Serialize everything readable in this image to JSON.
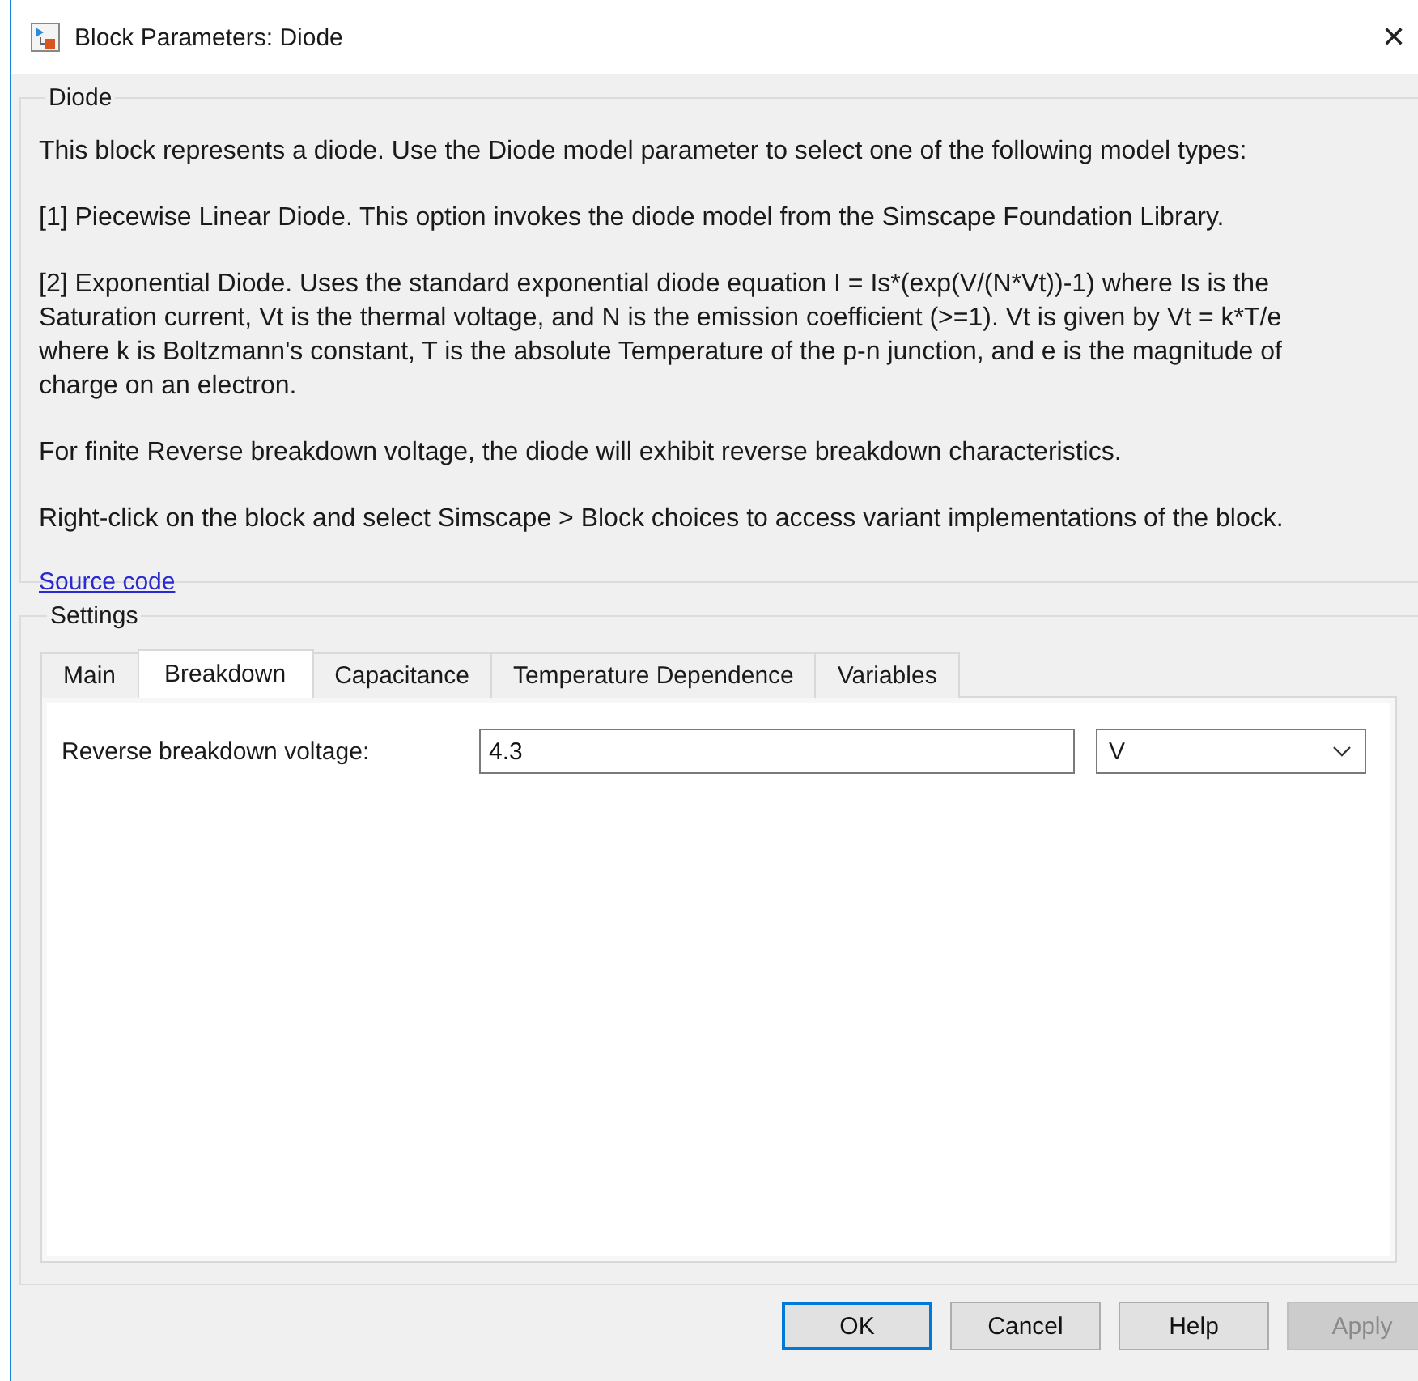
{
  "window": {
    "title": "Block Parameters: Diode",
    "close": "✕"
  },
  "description": {
    "title": "Diode",
    "paragraphs": [
      "This block represents a diode. Use the Diode model parameter to select one of the following model types:",
      "[1] Piecewise Linear Diode. This option invokes the diode model from the Simscape Foundation Library.",
      "[2] Exponential Diode. Uses the standard exponential diode equation I = Is*(exp(V/(N*Vt))-1) where Is is the Saturation current, Vt is the thermal voltage, and N is the emission coefficient (>=1). Vt is given by Vt = k*T/e where k is Boltzmann's constant, T is the absolute Temperature of the p-n junction, and e is the magnitude of charge on an electron.",
      "For finite Reverse breakdown voltage, the diode will exhibit reverse breakdown characteristics.",
      "Right-click on the block and select Simscape > Block choices to access variant implementations of the block."
    ],
    "link": "Source code"
  },
  "settings": {
    "title": "Settings",
    "tabs": [
      {
        "label": "Main",
        "selected": false
      },
      {
        "label": "Breakdown",
        "selected": true
      },
      {
        "label": "Capacitance",
        "selected": false
      },
      {
        "label": "Temperature Dependence",
        "selected": false
      },
      {
        "label": "Variables",
        "selected": false
      }
    ],
    "parameters": [
      {
        "label": "Reverse breakdown voltage:",
        "value": "4.3",
        "unit": "V"
      }
    ]
  },
  "buttons": [
    {
      "label": "OK",
      "default": true,
      "disabled": false
    },
    {
      "label": "Cancel",
      "default": false,
      "disabled": false
    },
    {
      "label": "Help",
      "default": false,
      "disabled": false
    },
    {
      "label": "Apply",
      "default": false,
      "disabled": true
    }
  ]
}
